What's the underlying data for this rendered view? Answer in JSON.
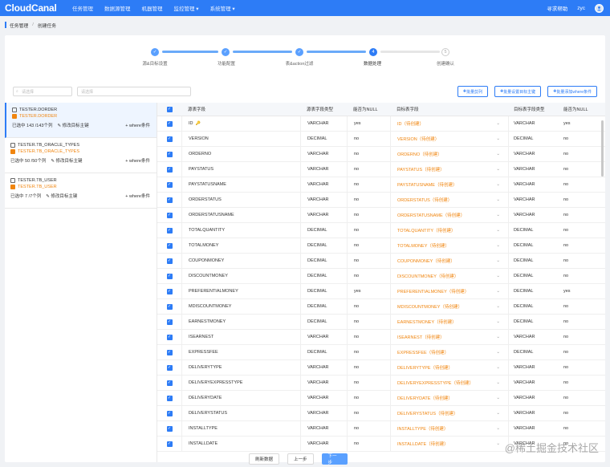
{
  "topbar": {
    "logo": "CloudCanal",
    "nav": [
      "任务管理",
      "数据源管理",
      "机器管理",
      "监控管理 ▾",
      "系统管理 ▾"
    ],
    "help": "寻求帮助",
    "user": "zyc",
    "avatar_icon": "user-avatar-icon"
  },
  "breadcrumb": {
    "root": "任务管理",
    "sep": "/",
    "current": "创建任务"
  },
  "steps": [
    "源&目标设置",
    "功能配置",
    "表&action过滤",
    "数据处理",
    "创建确认"
  ],
  "steps_active": "4",
  "steps_pending": "5",
  "filters": {
    "select_placeholder": "请选择",
    "input_placeholder": "请选择"
  },
  "buttons": {
    "batch_prune": "批量剪列",
    "batch_pk": "批量设置目标主键",
    "batch_where": "批量添加where条件"
  },
  "tables": [
    {
      "src": "TESTER.DORDER",
      "dst": "TESTER.DORDER",
      "meta": "已选中 143 /143个列",
      "edit": "修改目标主键",
      "where": "where条件"
    },
    {
      "src": "TESTER.TB_ORACLE_TYPES",
      "dst": "TESTER.TB_ORACLE_TYPES",
      "meta": "已选中 50 /50个列",
      "edit": "修改目标主键",
      "where": "where条件"
    },
    {
      "src": "TESTER.TB_USER",
      "dst": "TESTER.TB_USER",
      "meta": "已选中 7 /7个列",
      "edit": "修改目标主键",
      "where": "where条件"
    }
  ],
  "columns": {
    "src": "源表字段",
    "stype": "源表字段类型",
    "null": "能否为NULL",
    "dst": "目标表字段",
    "dtype": "目标表字段类型",
    "dnull": "能否为NULL"
  },
  "rows": [
    {
      "src": "ID",
      "stype": "VARCHAR",
      "null": "yes",
      "dst": "ID（待创建）",
      "dtype": "VARCHAR",
      "dnull": "yes",
      "key": "🔑"
    },
    {
      "src": "VERSION",
      "stype": "DECIMAL",
      "null": "no",
      "dst": "VERSION（待创建）",
      "dtype": "DECIMAL",
      "dnull": "no"
    },
    {
      "src": "ORDERNO",
      "stype": "VARCHAR",
      "null": "no",
      "dst": "ORDERNO（待创建）",
      "dtype": "VARCHAR",
      "dnull": "no"
    },
    {
      "src": "PAYSTATUS",
      "stype": "VARCHAR",
      "null": "no",
      "dst": "PAYSTATUS（待创建）",
      "dtype": "VARCHAR",
      "dnull": "no"
    },
    {
      "src": "PAYSTATUSNAME",
      "stype": "VARCHAR",
      "null": "no",
      "dst": "PAYSTATUSNAME（待创建）",
      "dtype": "VARCHAR",
      "dnull": "no"
    },
    {
      "src": "ORDERSTATUS",
      "stype": "VARCHAR",
      "null": "no",
      "dst": "ORDERSTATUS（待创建）",
      "dtype": "VARCHAR",
      "dnull": "no"
    },
    {
      "src": "ORDERSTATUSNAME",
      "stype": "VARCHAR",
      "null": "no",
      "dst": "ORDERSTATUSNAME（待创建）",
      "dtype": "VARCHAR",
      "dnull": "no"
    },
    {
      "src": "TOTALQUANTITY",
      "stype": "DECIMAL",
      "null": "no",
      "dst": "TOTALQUANTITY（待创建）",
      "dtype": "DECIMAL",
      "dnull": "no"
    },
    {
      "src": "TOTALMONEY",
      "stype": "DECIMAL",
      "null": "no",
      "dst": "TOTALMONEY（待创建）",
      "dtype": "DECIMAL",
      "dnull": "no"
    },
    {
      "src": "COUPONMONEY",
      "stype": "DECIMAL",
      "null": "no",
      "dst": "COUPONMONEY（待创建）",
      "dtype": "DECIMAL",
      "dnull": "no"
    },
    {
      "src": "DISCOUNTMONEY",
      "stype": "DECIMAL",
      "null": "no",
      "dst": "DISCOUNTMONEY（待创建）",
      "dtype": "DECIMAL",
      "dnull": "no"
    },
    {
      "src": "PREFERENTIALMONEY",
      "stype": "DECIMAL",
      "null": "yes",
      "dst": "PREFERENTIALMONEY（待创建）",
      "dtype": "DECIMAL",
      "dnull": "yes"
    },
    {
      "src": "MDISCOUNTMONEY",
      "stype": "DECIMAL",
      "null": "no",
      "dst": "MDISCOUNTMONEY（待创建）",
      "dtype": "DECIMAL",
      "dnull": "no"
    },
    {
      "src": "EARNESTMONEY",
      "stype": "DECIMAL",
      "null": "no",
      "dst": "EARNESTMONEY（待创建）",
      "dtype": "DECIMAL",
      "dnull": "no"
    },
    {
      "src": "ISEARNEST",
      "stype": "VARCHAR",
      "null": "no",
      "dst": "ISEARNEST（待创建）",
      "dtype": "VARCHAR",
      "dnull": "no"
    },
    {
      "src": "EXPRESSFEE",
      "stype": "DECIMAL",
      "null": "no",
      "dst": "EXPRESSFEE（待创建）",
      "dtype": "DECIMAL",
      "dnull": "no"
    },
    {
      "src": "DELIVERYTYPE",
      "stype": "VARCHAR",
      "null": "no",
      "dst": "DELIVERYTYPE（待创建）",
      "dtype": "VARCHAR",
      "dnull": "no"
    },
    {
      "src": "DELIVERYEXPRESSTYPE",
      "stype": "VARCHAR",
      "null": "no",
      "dst": "DELIVERYEXPRESSTYPE（待创建）",
      "dtype": "VARCHAR",
      "dnull": "no"
    },
    {
      "src": "DELIVERYDATE",
      "stype": "VARCHAR",
      "null": "no",
      "dst": "DELIVERYDATE（待创建）",
      "dtype": "VARCHAR",
      "dnull": "no"
    },
    {
      "src": "DELIVERYSTATUS",
      "stype": "VARCHAR",
      "null": "no",
      "dst": "DELIVERYSTATUS（待创建）",
      "dtype": "VARCHAR",
      "dnull": "no"
    },
    {
      "src": "INSTALLTYPE",
      "stype": "VARCHAR",
      "null": "no",
      "dst": "INSTALLTYPE（待创建）",
      "dtype": "VARCHAR",
      "dnull": "no"
    },
    {
      "src": "INSTALLDATE",
      "stype": "VARCHAR",
      "null": "no",
      "dst": "INSTALLDATE（待创建）",
      "dtype": "VARCHAR",
      "dnull": "no"
    }
  ],
  "footer": {
    "refresh": "刷新数据",
    "prev": "上一步",
    "next": "下一步"
  },
  "watermark": "@稀土掘金技术社区",
  "colors": {
    "primary": "#2d7cf6",
    "target": "#f0850f"
  }
}
